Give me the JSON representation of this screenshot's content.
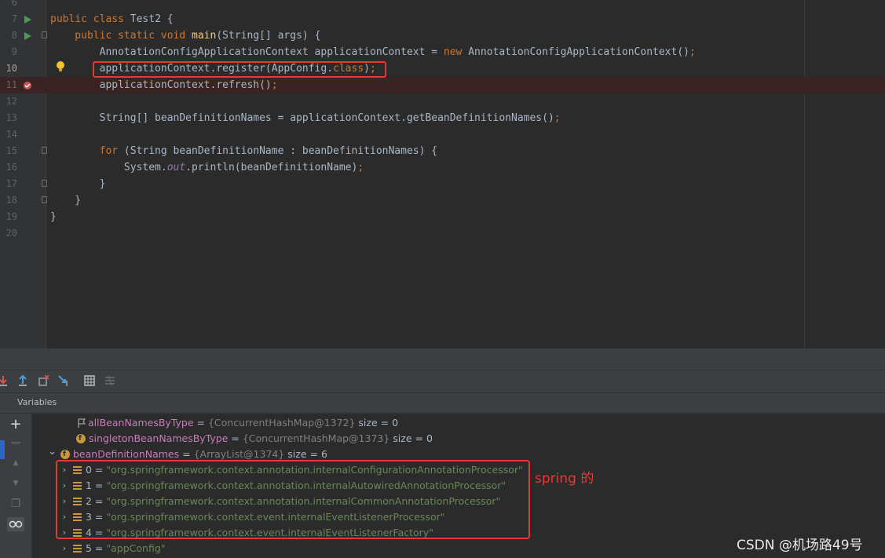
{
  "editor": {
    "lines": [
      {
        "num": "6",
        "segments": []
      },
      {
        "num": "7",
        "segments": [
          {
            "t": "public ",
            "c": "kw"
          },
          {
            "t": "class ",
            "c": "kw"
          },
          {
            "t": "Test2 {",
            "c": ""
          }
        ]
      },
      {
        "num": "8",
        "segments": [
          {
            "t": "    public ",
            "c": "kw"
          },
          {
            "t": "static ",
            "c": "kw"
          },
          {
            "t": "void ",
            "c": "kw"
          },
          {
            "t": "main",
            "c": "fn"
          },
          {
            "t": "(String[] args) {",
            "c": ""
          }
        ]
      },
      {
        "num": "9",
        "segments": [
          {
            "t": "        AnnotationConfigApplicationContext applicationContext = ",
            "c": ""
          },
          {
            "t": "new ",
            "c": "kw"
          },
          {
            "t": "AnnotationConfigApplicationContext()",
            "c": ""
          },
          {
            "t": ";",
            "c": "kw"
          }
        ]
      },
      {
        "num": "10",
        "segments": [
          {
            "t": "        applicationContext.register(AppConfig.",
            "c": ""
          },
          {
            "t": "class",
            "c": "kw"
          },
          {
            "t": ")",
            "c": ""
          },
          {
            "t": ";",
            "c": "kw"
          }
        ]
      },
      {
        "num": "11",
        "segments": [
          {
            "t": "        applicationContext.refresh()",
            "c": ""
          },
          {
            "t": ";",
            "c": "kw"
          }
        ]
      },
      {
        "num": "12",
        "segments": []
      },
      {
        "num": "13",
        "segments": [
          {
            "t": "        String[] beanDefinitionNames = applicationContext.getBeanDefinitionNames()",
            "c": ""
          },
          {
            "t": ";",
            "c": "kw"
          }
        ]
      },
      {
        "num": "14",
        "segments": []
      },
      {
        "num": "15",
        "segments": [
          {
            "t": "        for ",
            "c": "kw"
          },
          {
            "t": "(String beanDefinitionName : beanDefinitionNames) {",
            "c": ""
          }
        ]
      },
      {
        "num": "16",
        "segments": [
          {
            "t": "            System.",
            "c": ""
          },
          {
            "t": "out",
            "c": "st"
          },
          {
            "t": ".println(beanDefinitionName)",
            "c": ""
          },
          {
            "t": ";",
            "c": "kw"
          }
        ]
      },
      {
        "num": "17",
        "segments": [
          {
            "t": "        }",
            "c": ""
          }
        ]
      },
      {
        "num": "18",
        "segments": [
          {
            "t": "    }",
            "c": ""
          }
        ]
      },
      {
        "num": "19",
        "segments": [
          {
            "t": "}",
            "c": ""
          }
        ]
      },
      {
        "num": "20",
        "segments": []
      }
    ],
    "run_icon": "run-gutter-icon",
    "breakpoint_icon": "breakpoint-icon",
    "bulb_icon": "lightbulb-icon"
  },
  "debug": {
    "variables_title": "Variables",
    "toolbar_icons": [
      "step-into-icon",
      "step-out-icon",
      "drop-frame-icon",
      "run-to-cursor-icon",
      "evaluate-table-icon",
      "trace-icon"
    ],
    "side_icons": [
      "add-watch-icon",
      "remove-icon",
      "up-icon",
      "down-icon",
      "copy-icon",
      "glasses-icon"
    ],
    "rows": [
      {
        "indent": 0,
        "chev": "",
        "icon": "flag",
        "name": "allBeanNamesByType",
        "eq": " = ",
        "type": "{ConcurrentHashMap@1372}",
        "extra": "  size = 0",
        "nameclass": "vname"
      },
      {
        "indent": 0,
        "chev": "",
        "icon": "field",
        "name": "singletonBeanNamesByType",
        "eq": " = ",
        "type": "{ConcurrentHashMap@1373}",
        "extra": "  size = 0",
        "nameclass": "vname"
      },
      {
        "indent": 0,
        "chev": "⌄",
        "icon": "field",
        "name": "beanDefinitionNames",
        "eq": " = ",
        "type": "{ArrayList@1374}",
        "extra": "  size = 6",
        "nameclass": "vname"
      },
      {
        "indent": 1,
        "chev": "›",
        "icon": "lines",
        "name": "0",
        "eq": " = ",
        "str": "\"org.springframework.context.annotation.internalConfigurationAnnotationProcessor\""
      },
      {
        "indent": 1,
        "chev": "›",
        "icon": "lines",
        "name": "1",
        "eq": " = ",
        "str": "\"org.springframework.context.annotation.internalAutowiredAnnotationProcessor\""
      },
      {
        "indent": 1,
        "chev": "›",
        "icon": "lines",
        "name": "2",
        "eq": " = ",
        "str": "\"org.springframework.context.annotation.internalCommonAnnotationProcessor\""
      },
      {
        "indent": 1,
        "chev": "›",
        "icon": "lines",
        "name": "3",
        "eq": " = ",
        "str": "\"org.springframework.context.event.internalEventListenerProcessor\""
      },
      {
        "indent": 1,
        "chev": "›",
        "icon": "lines",
        "name": "4",
        "eq": " = ",
        "str": "\"org.springframework.context.event.internalEventListenerFactory\""
      },
      {
        "indent": 1,
        "chev": "›",
        "icon": "lines",
        "name": "5",
        "eq": " = ",
        "str": "\"appConfig\""
      }
    ]
  },
  "annotation": {
    "note": "spring 的"
  },
  "watermark": "CSDN @机场路49号",
  "colors": {
    "keyword": "#cc7832",
    "method": "#ffc66d",
    "string": "#6a8759",
    "field": "#c77dbb",
    "highlight": "#e53935"
  }
}
